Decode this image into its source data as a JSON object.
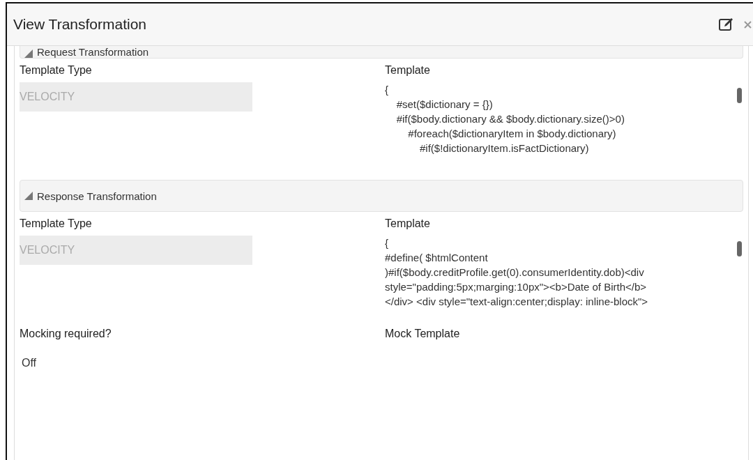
{
  "window": {
    "title": "View Transformation"
  },
  "sections": [
    {
      "title": "Request Transformation",
      "expanded": true,
      "template_type_label": "Template Type",
      "template_type": "VELOCITY",
      "template_label": "Template",
      "template_lines": [
        "{",
        "\t#set($dictionary = {})",
        "\t#if($body.dictionary && $body.dictionary.size()>0)",
        "\t\t#foreach($dictionaryItem in $body.dictionary)",
        "\t\t\t#if($!dictionaryItem.isFactDictionary)"
      ]
    },
    {
      "title": "Response Transformation",
      "expanded": true,
      "template_type_label": "Template Type",
      "template_type": "VELOCITY",
      "template_label": "Template",
      "template_lines": [
        "{",
        "#define( $htmlContent",
        ")#if($body.creditProfile.get(0).consumerIdentity.dob)<div",
        "style=\"padding:5px;marging:10px\"><b>Date of Birth</b>",
        "</div> <div style=\"text-align:center;display: inline-block\">"
      ]
    }
  ],
  "mocking": {
    "label": "Mocking required?",
    "value": "Off",
    "mock_template_label": "Mock Template"
  }
}
